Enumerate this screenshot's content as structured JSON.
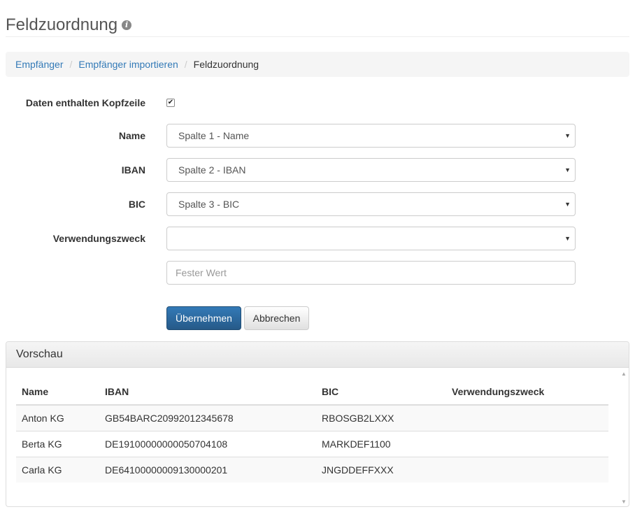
{
  "page": {
    "title": "Feldzuordnung",
    "info_icon": "info-circle"
  },
  "breadcrumb": {
    "items": [
      "Empfänger",
      "Empfänger importieren"
    ],
    "active": "Feldzuordnung",
    "separator": "/"
  },
  "form": {
    "header_label": "Daten enthalten Kopfzeile",
    "header_checked": true,
    "name_label": "Name",
    "name_value": "Spalte 1 - Name",
    "iban_label": "IBAN",
    "iban_value": "Spalte 2 - IBAN",
    "bic_label": "BIC",
    "bic_value": "Spalte 3 - BIC",
    "purpose_label": "Verwendungszweck",
    "purpose_value": "",
    "fixed_value_placeholder": "Fester Wert",
    "apply_label": "Übernehmen",
    "cancel_label": "Abbrechen"
  },
  "preview": {
    "title": "Vorschau",
    "columns": [
      "Name",
      "IBAN",
      "BIC",
      "Verwendungszweck"
    ],
    "rows": [
      [
        "Anton KG",
        "GB54BARC20992012345678",
        "RBOSGB2LXXX",
        ""
      ],
      [
        "Berta KG",
        "DE19100000000050704108",
        "MARKDEF1100",
        ""
      ],
      [
        "Carla KG",
        "DE64100000009130000201",
        "JNGDDEFFXXX",
        ""
      ]
    ]
  },
  "colors": {
    "primary": "#337ab7",
    "link": "#337ab7"
  }
}
